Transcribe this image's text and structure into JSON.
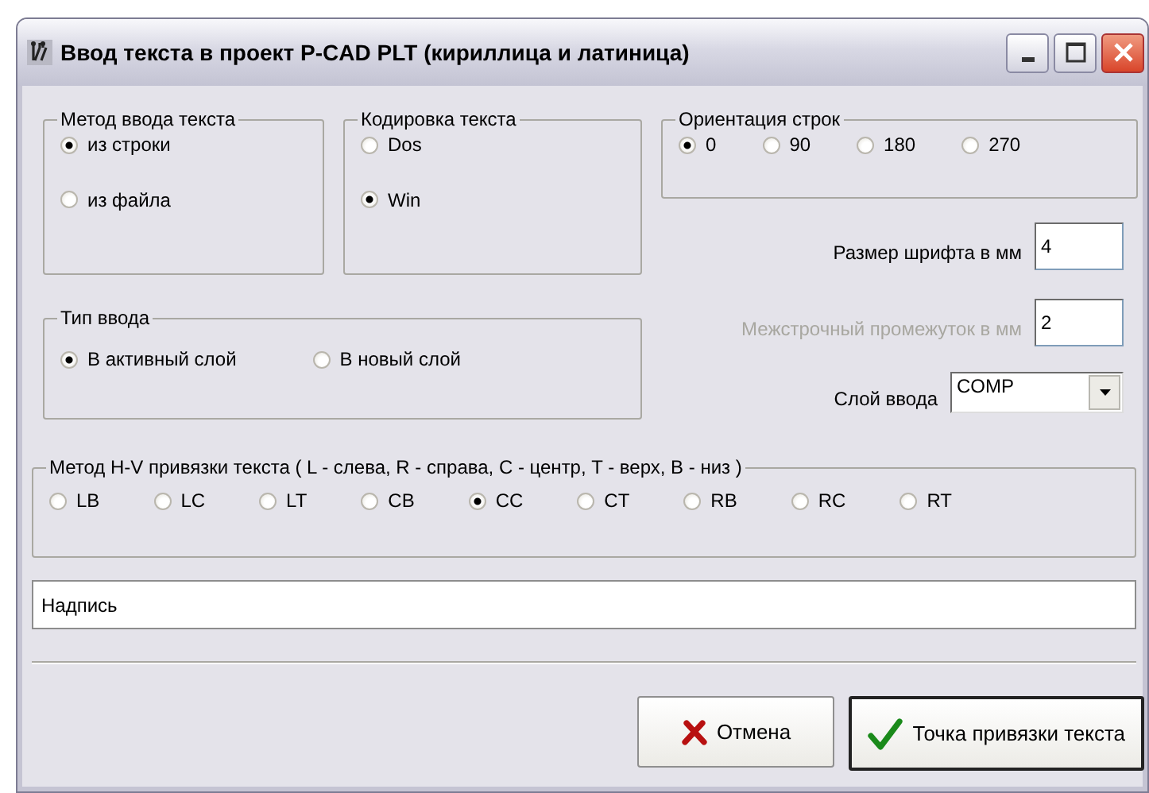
{
  "window": {
    "title": "Ввод текста в проект P-CAD PLT (кириллица и латиница)"
  },
  "input_method": {
    "label": "Метод ввода текста",
    "options": [
      {
        "label": "из строки",
        "selected": true
      },
      {
        "label": "из файла",
        "selected": false
      }
    ]
  },
  "encoding": {
    "label": "Кодировка текста",
    "options": [
      {
        "label": "Dos",
        "selected": false
      },
      {
        "label": "Win",
        "selected": true
      }
    ]
  },
  "orientation": {
    "label": "Ориентация  строк",
    "options": [
      {
        "label": "0",
        "selected": true
      },
      {
        "label": "90",
        "selected": false
      },
      {
        "label": "180",
        "selected": false
      },
      {
        "label": "270",
        "selected": false
      }
    ]
  },
  "input_type": {
    "label": "Тип ввода",
    "options": [
      {
        "label": "В активный слой",
        "selected": true
      },
      {
        "label": "В новый слой",
        "selected": false
      }
    ]
  },
  "font_size": {
    "label": "Размер шрифта в мм",
    "value": "4",
    "disabled": false
  },
  "line_spacing": {
    "label": "Межстрочный промежуток в мм",
    "value": "2",
    "disabled": true
  },
  "layer": {
    "label": "Слой ввода",
    "value": "COMP"
  },
  "hv_anchor": {
    "label": "Метод H-V привязки текста  ( L - слева, R - справа, C - центр, T - верх, B - низ )",
    "options": [
      {
        "label": "LB",
        "selected": false
      },
      {
        "label": "LC",
        "selected": false
      },
      {
        "label": "LT",
        "selected": false
      },
      {
        "label": "CB",
        "selected": false
      },
      {
        "label": "CC",
        "selected": true
      },
      {
        "label": "CT",
        "selected": false
      },
      {
        "label": "RB",
        "selected": false
      },
      {
        "label": "RC",
        "selected": false
      },
      {
        "label": "RT",
        "selected": false
      }
    ]
  },
  "text_field": {
    "value": "Надпись"
  },
  "buttons": [
    {
      "label": "Отмена",
      "kind": "cancel",
      "default": false
    },
    {
      "label": "Точка привязки текста",
      "kind": "ok",
      "default": true
    }
  ]
}
